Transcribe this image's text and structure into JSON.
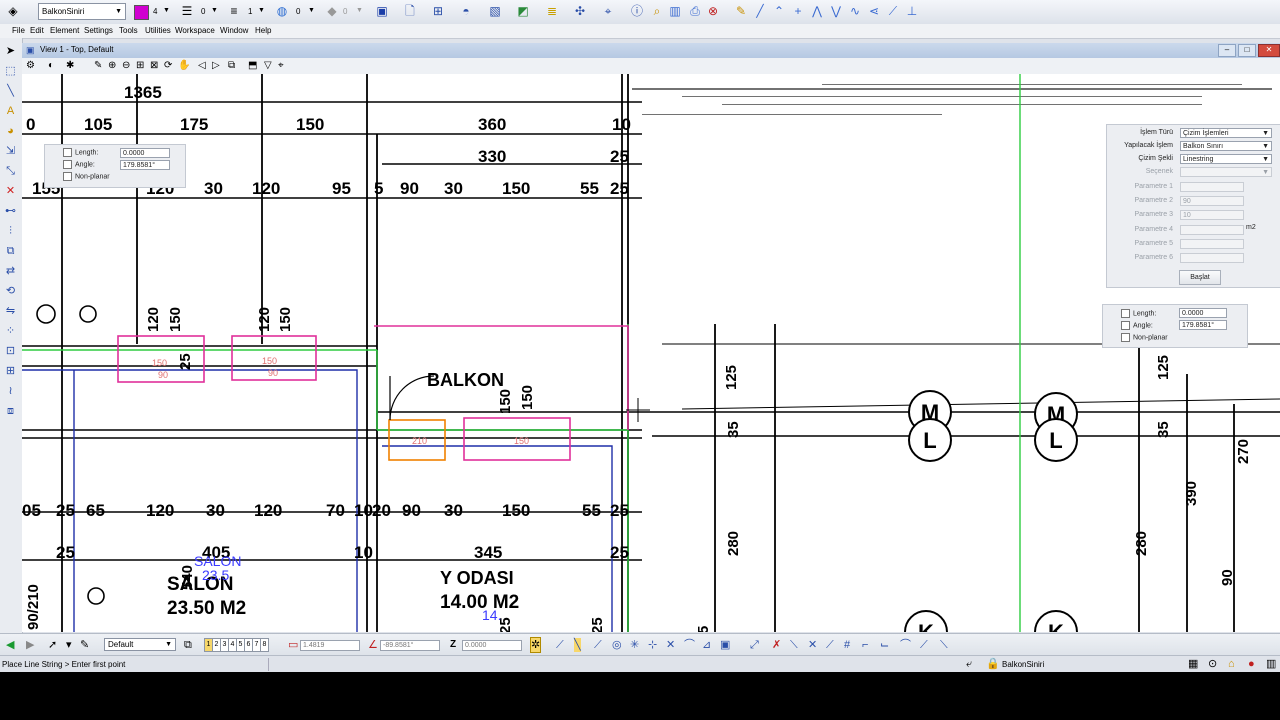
{
  "toolbar": {
    "level": "BalkonSiniri",
    "color_value": "4",
    "style_value": "0",
    "weight_value": "1",
    "transparency_value": "0",
    "priority_value": "0",
    "active_color": "#d000d0"
  },
  "menu": [
    "File",
    "Edit",
    "Element",
    "Settings",
    "Tools",
    "Utilities",
    "Workspace",
    "Window",
    "Help"
  ],
  "view": {
    "title": "View 1 - Top, Default"
  },
  "accudraw_small": {
    "length_label": "Length:",
    "length_value": "0.0000",
    "angle_label": "Angle:",
    "angle_value": "179.8581°",
    "nonplanar_label": "Non-planar"
  },
  "tool_settings": {
    "islem_turu_label": "İşlem Türü",
    "islem_turu_value": "Çizim İşlemleri",
    "yapilacak_label": "Yapılacak İşlem",
    "yapilacak_value": "Balkon Sınırı",
    "cizim_sekli_label": "Çizim Şekli",
    "cizim_sekli_value": "Linestring",
    "secenek_label": "Seçenek",
    "secenek_value": "",
    "parametre1_label": "Parametre 1",
    "parametre1_value": "",
    "parametre2_label": "Parametre 2",
    "parametre2_value": "90",
    "parametre3_label": "Parametre 3",
    "parametre3_value": "10",
    "parametre4_label": "Parametre 4",
    "parametre4_value": "",
    "parametre4_unit": "m2",
    "parametre5_label": "Parametre 5",
    "parametre5_value": "",
    "parametre6_label": "Parametre 6",
    "parametre6_value": "",
    "start_button": "Başlat"
  },
  "accudraw_right": {
    "length_label": "Length:",
    "length_value": "0.0000",
    "angle_label": "Angle:",
    "angle_value": "179.8581°",
    "nonplanar_label": "Non-planar"
  },
  "drawing": {
    "dims_row1": [
      "1365"
    ],
    "dims_row2": [
      "0",
      "105",
      "175",
      "150",
      "360",
      "10"
    ],
    "dims_row3": [
      "330",
      "25"
    ],
    "dims_row4": [
      "155",
      "120",
      "30",
      "120",
      "95",
      "5",
      "90",
      "30",
      "150",
      "55",
      "25"
    ],
    "dims_row5": [
      "05",
      "25",
      "65",
      "120",
      "30",
      "120",
      "70",
      "10",
      "20",
      "90",
      "30",
      "150",
      "55",
      "25"
    ],
    "dims_row6": [
      "25",
      "405",
      "10",
      "345",
      "25"
    ],
    "vertical_dims": [
      "120",
      "150",
      "120",
      "150",
      "125",
      "35",
      "125",
      "35",
      "280",
      "280",
      "390",
      "270",
      "90",
      "90/210",
      "150",
      "150",
      "540",
      "25",
      "5",
      "25",
      "25"
    ],
    "rooms": [
      {
        "name": "BALKON"
      },
      {
        "name": "SALON",
        "area": "23.50 M2",
        "note": "SALON",
        "note_area": "23.5"
      },
      {
        "name": "Y ODASI",
        "area": "14.00 M2",
        "note": "14."
      }
    ],
    "circles": [
      "M",
      "L",
      "M",
      "L",
      "K",
      "K"
    ],
    "window_labels": [
      "150",
      "90",
      "150",
      "90",
      "210",
      "150"
    ]
  },
  "bottombar": {
    "view_combo": "Default",
    "view_buttons": [
      "1",
      "2",
      "3",
      "4",
      "5",
      "6",
      "7",
      "8"
    ],
    "x_value": "1.4819",
    "angle_value": "-89.8581°",
    "z_label": "Z",
    "z_value": "0.0000"
  },
  "status": {
    "prompt": "Place Line String > Enter first point",
    "active_level": "BalkonSiniri"
  }
}
